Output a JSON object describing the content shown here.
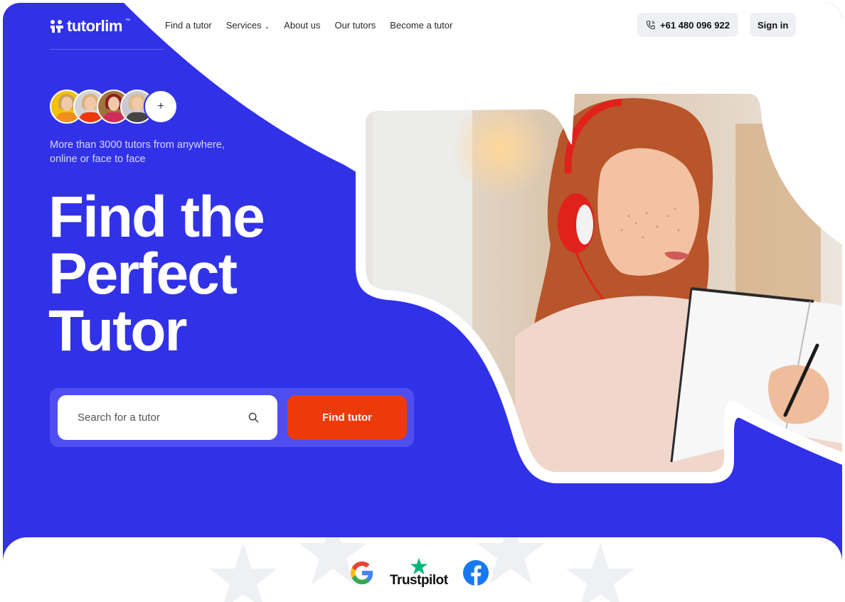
{
  "brand": {
    "name": "tutorlim",
    "tm": "™"
  },
  "nav": {
    "items": [
      {
        "label": "Find a tutor",
        "has_dropdown": false
      },
      {
        "label": "Services",
        "has_dropdown": true
      },
      {
        "label": "About us",
        "has_dropdown": false
      },
      {
        "label": "Our tutors",
        "has_dropdown": false
      },
      {
        "label": "Become a tutor",
        "has_dropdown": false
      }
    ],
    "phone": "+61 480 096 922",
    "signin": "Sign in"
  },
  "hero": {
    "tagline": "More than 3000 tutors from anywhere, online or face to face",
    "headline_lines": [
      "Find the",
      "Perfect",
      "Tutor"
    ],
    "avatar_more": "+",
    "search": {
      "placeholder": "Search for a tutor",
      "button": "Find tutor"
    }
  },
  "reviews": {
    "trustpilot": "Trustpilot",
    "google_letter": "G"
  },
  "colors": {
    "primary": "#3131e8",
    "accent": "#ee3a0a",
    "trustpilot": "#00b67a",
    "facebook": "#1877f2"
  },
  "icons": [
    "logo-mark-icon",
    "chevron-down-icon",
    "phone-icon",
    "search-icon",
    "google-icon",
    "trustpilot-star-icon",
    "facebook-icon",
    "background-star-icon"
  ]
}
